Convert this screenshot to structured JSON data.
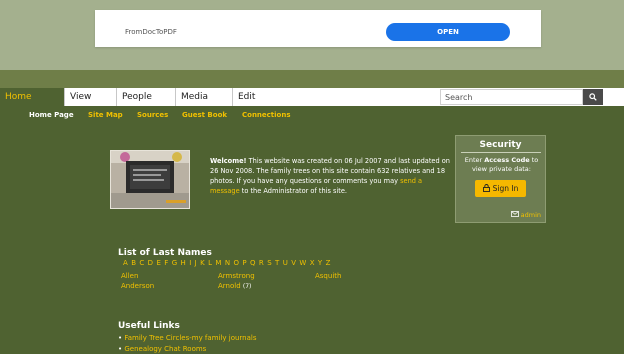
{
  "ad": {
    "text": "FromDocToPDF",
    "button": "OPEN"
  },
  "nav": {
    "items": [
      "Home",
      "View",
      "People",
      "Media",
      "Edit"
    ],
    "search_placeholder": "Search",
    "search_icon": "search-icon"
  },
  "sublinks": [
    "Home Page",
    "Site Map",
    "Sources",
    "Guest Book",
    "Connections"
  ],
  "welcome": {
    "bold": "Welcome!",
    "text1": " This website was created on 06 Jul 2007 and last updated on 26 Nov 2008. The family trees on this site contain 632 relatives and 18 photos. If you have any questions or comments you may ",
    "link": "send a message",
    "text2": " to the Administrator of this site."
  },
  "security": {
    "title": "Security",
    "text_prefix": "Enter ",
    "text_bold": "Access Code",
    "text_suffix": " to view private data:",
    "signin": "Sign In",
    "admin": "admin"
  },
  "last_names": {
    "heading": "List of Last Names",
    "letters": [
      "A",
      "B",
      "C",
      "D",
      "E",
      "F",
      "G",
      "H",
      "I",
      "J",
      "K",
      "L",
      "M",
      "N",
      "O",
      "P",
      "Q",
      "R",
      "S",
      "T",
      "U",
      "V",
      "W",
      "X",
      "Y",
      "Z"
    ],
    "names": [
      {
        "name": "Allen",
        "count": ""
      },
      {
        "name": "Anderson",
        "count": ""
      },
      {
        "name": "Armstrong",
        "count": ""
      },
      {
        "name": "Arnold",
        "count": "(7)"
      },
      {
        "name": "Asquith",
        "count": ""
      }
    ]
  },
  "useful_links": {
    "heading": "Useful Links",
    "links": [
      "Family Tree Circles-my family journals",
      "Genealogy Chat Rooms"
    ]
  },
  "colors": {
    "background": "#4f6231",
    "accent": "#f0c000",
    "signin": "#f5b800",
    "open_button": "#1a73e8"
  }
}
